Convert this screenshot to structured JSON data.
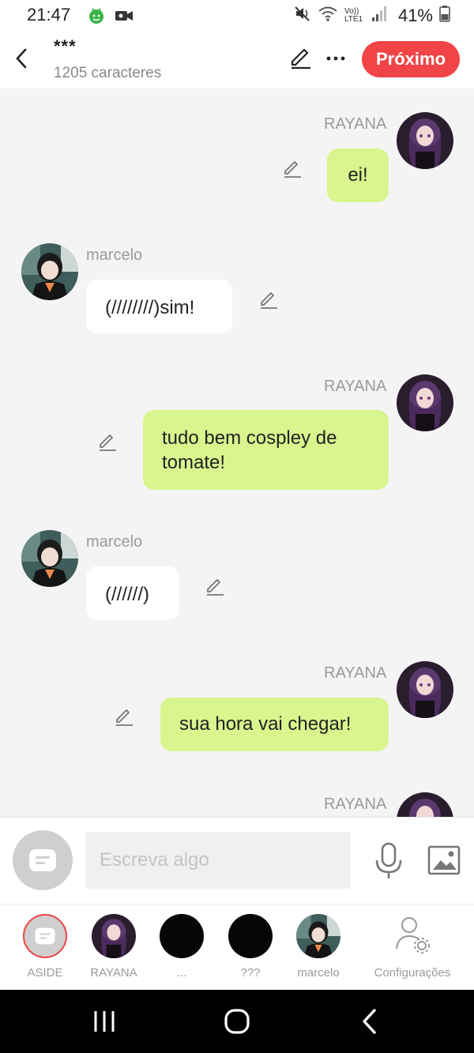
{
  "status": {
    "time": "21:47",
    "battery": "41%",
    "network": "Vo)) LTE1"
  },
  "header": {
    "title": "***",
    "subtitle": "1205 caracteres",
    "next_label": "Próximo"
  },
  "messages": [
    {
      "side": "right",
      "sender": "RAYANA",
      "text": "ei!"
    },
    {
      "side": "left",
      "sender": "marcelo",
      "text": "(////////)sim!"
    },
    {
      "side": "right",
      "sender": "RAYANA",
      "text": "tudo bem cospley de tomate!"
    },
    {
      "side": "left",
      "sender": "marcelo",
      "text": "(//////)"
    },
    {
      "side": "right",
      "sender": "RAYANA",
      "text": "sua hora vai chegar!"
    },
    {
      "side": "right",
      "sender": "RAYANA",
      "text": ""
    }
  ],
  "input": {
    "placeholder": "Escreva algo"
  },
  "tabs": [
    {
      "label": "ASIDE",
      "icon": "aside-icon"
    },
    {
      "label": "RAYANA",
      "icon": "rayana-avatar"
    },
    {
      "label": "...",
      "icon": "black-circle"
    },
    {
      "label": "???",
      "icon": "black-circle"
    },
    {
      "label": "marcelo",
      "icon": "marcelo-avatar"
    },
    {
      "label": "Configurações",
      "icon": "settings-user-icon"
    }
  ],
  "colors": {
    "accent": "#f04447",
    "bubble_right": "#d8f58e",
    "bubble_left": "#ffffff",
    "background": "#f4f4f4"
  }
}
